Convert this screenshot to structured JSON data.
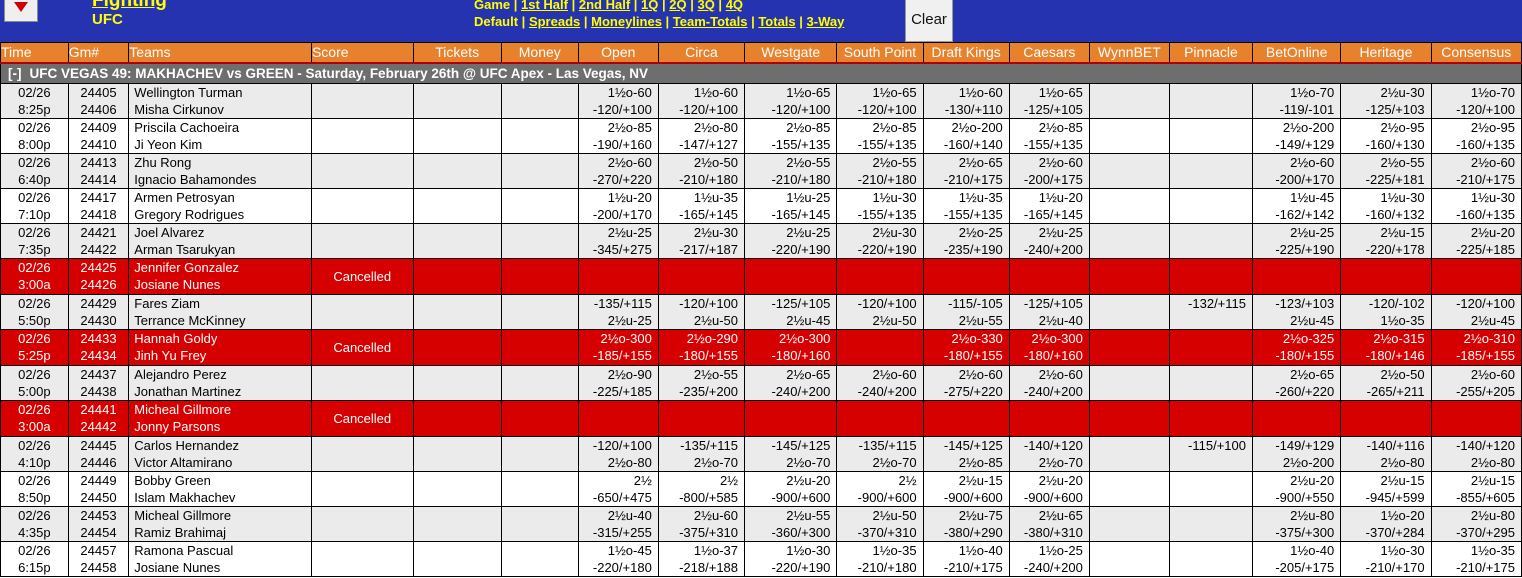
{
  "header": {
    "collapse_icon": "triangle-down",
    "league": "Fighting",
    "league_sub": "UFC",
    "periods": {
      "current": "Game",
      "options": [
        "1st Half",
        "2nd Half",
        "1Q",
        "2Q",
        "3Q",
        "4Q"
      ]
    },
    "bettypes": {
      "current": "Default",
      "options": [
        "Spreads",
        "Moneylines",
        "Team-Totals",
        "Totals",
        "3-Way"
      ]
    },
    "clear_label": "Clear",
    "accent_blue": "#2633b0",
    "accent_yellow": "#ffff00",
    "accent_orange": "#e8812c",
    "cancel_red": "#d60000"
  },
  "columns": [
    "Time",
    "Gm#",
    "Teams",
    "Score",
    "Tickets",
    "Money",
    "Open",
    "Circa",
    "Westgate",
    "South Point",
    "Draft Kings",
    "Caesars",
    "WynnBET",
    "Pinnacle",
    "BetOnline",
    "Heritage",
    "Consensus"
  ],
  "event": {
    "toggle": "[-]",
    "title": "UFC VEGAS 49: MAKHACHEV vs GREEN - Saturday, February 26th @ UFC Apex - Las Vegas, NV"
  },
  "rows": [
    {
      "date": "02/26",
      "time": "8:25p",
      "gm1": "24405",
      "gm2": "24406",
      "team1": "Wellington Turman",
      "team2": "Misha Cirkunov",
      "score": "",
      "tickets": [
        "",
        ""
      ],
      "money": [
        "",
        ""
      ],
      "cancelled": false,
      "books": {
        "open": [
          "1½o-60",
          "-120/+100"
        ],
        "circa": [
          "1½o-60",
          "-120/+100"
        ],
        "westgate": [
          "1½o-65",
          "-120/+100"
        ],
        "southpoint": [
          "1½o-65",
          "-120/+100"
        ],
        "draftkings": [
          "1½o-60",
          "-130/+110"
        ],
        "caesars": [
          "1½o-65",
          "-125/+105"
        ],
        "wynnbet": [
          "",
          ""
        ],
        "pinnacle": [
          "",
          ""
        ],
        "betonline": [
          "1½o-70",
          "-119/-101"
        ],
        "heritage": [
          "2½u-30",
          "-125/+103"
        ],
        "consensus": [
          "1½o-70",
          "-120/+100"
        ]
      }
    },
    {
      "date": "02/26",
      "time": "8:00p",
      "gm1": "24409",
      "gm2": "24410",
      "team1": "Priscila Cachoeira",
      "team2": "Ji Yeon Kim",
      "score": "",
      "tickets": [
        "",
        ""
      ],
      "money": [
        "",
        ""
      ],
      "cancelled": false,
      "books": {
        "open": [
          "2½o-85",
          "-190/+160"
        ],
        "circa": [
          "2½o-80",
          "-147/+127"
        ],
        "westgate": [
          "2½o-85",
          "-155/+135"
        ],
        "southpoint": [
          "2½o-85",
          "-155/+135"
        ],
        "draftkings": [
          "2½o-200",
          "-160/+140"
        ],
        "caesars": [
          "2½o-85",
          "-155/+135"
        ],
        "wynnbet": [
          "",
          ""
        ],
        "pinnacle": [
          "",
          ""
        ],
        "betonline": [
          "2½o-200",
          "-149/+129"
        ],
        "heritage": [
          "2½o-95",
          "-160/+130"
        ],
        "consensus": [
          "2½o-95",
          "-160/+135"
        ]
      }
    },
    {
      "date": "02/26",
      "time": "6:40p",
      "gm1": "24413",
      "gm2": "24414",
      "team1": "Zhu Rong",
      "team2": "Ignacio Bahamondes",
      "score": "",
      "tickets": [
        "",
        ""
      ],
      "money": [
        "",
        ""
      ],
      "cancelled": false,
      "books": {
        "open": [
          "2½o-60",
          "-270/+220"
        ],
        "circa": [
          "2½o-50",
          "-210/+180"
        ],
        "westgate": [
          "2½o-55",
          "-210/+180"
        ],
        "southpoint": [
          "2½o-55",
          "-210/+180"
        ],
        "draftkings": [
          "2½o-65",
          "-210/+175"
        ],
        "caesars": [
          "2½o-60",
          "-200/+175"
        ],
        "wynnbet": [
          "",
          ""
        ],
        "pinnacle": [
          "",
          ""
        ],
        "betonline": [
          "2½o-60",
          "-200/+170"
        ],
        "heritage": [
          "2½o-55",
          "-225/+181"
        ],
        "consensus": [
          "2½o-60",
          "-210/+175"
        ]
      }
    },
    {
      "date": "02/26",
      "time": "7:10p",
      "gm1": "24417",
      "gm2": "24418",
      "team1": "Armen Petrosyan",
      "team2": "Gregory Rodrigues",
      "score": "",
      "tickets": [
        "",
        ""
      ],
      "money": [
        "",
        ""
      ],
      "cancelled": false,
      "books": {
        "open": [
          "1½u-20",
          "-200/+170"
        ],
        "circa": [
          "1½u-35",
          "-165/+145"
        ],
        "westgate": [
          "1½u-25",
          "-165/+145"
        ],
        "southpoint": [
          "1½u-30",
          "-155/+135"
        ],
        "draftkings": [
          "1½u-35",
          "-155/+135"
        ],
        "caesars": [
          "1½u-20",
          "-165/+145"
        ],
        "wynnbet": [
          "",
          ""
        ],
        "pinnacle": [
          "",
          ""
        ],
        "betonline": [
          "1½u-45",
          "-162/+142"
        ],
        "heritage": [
          "1½u-30",
          "-160/+132"
        ],
        "consensus": [
          "1½u-30",
          "-160/+135"
        ]
      }
    },
    {
      "date": "02/26",
      "time": "7:35p",
      "gm1": "24421",
      "gm2": "24422",
      "team1": "Joel Alvarez",
      "team2": "Arman Tsarukyan",
      "score": "",
      "tickets": [
        "",
        ""
      ],
      "money": [
        "",
        ""
      ],
      "cancelled": false,
      "books": {
        "open": [
          "2½u-25",
          "-345/+275"
        ],
        "circa": [
          "2½u-30",
          "-217/+187"
        ],
        "westgate": [
          "2½u-25",
          "-220/+190"
        ],
        "southpoint": [
          "2½u-30",
          "-220/+190"
        ],
        "draftkings": [
          "2½o-25",
          "-235/+190"
        ],
        "caesars": [
          "2½u-25",
          "-240/+200"
        ],
        "wynnbet": [
          "",
          ""
        ],
        "pinnacle": [
          "",
          ""
        ],
        "betonline": [
          "2½u-25",
          "-225/+190"
        ],
        "heritage": [
          "2½u-15",
          "-220/+178"
        ],
        "consensus": [
          "2½u-20",
          "-225/+185"
        ]
      }
    },
    {
      "date": "02/26",
      "time": "3:00a",
      "gm1": "24425",
      "gm2": "24426",
      "team1": "Jennifer Gonzalez",
      "team2": "Josiane Nunes",
      "score": "Cancelled",
      "tickets": [
        "",
        ""
      ],
      "money": [
        "",
        ""
      ],
      "cancelled": true,
      "books": {
        "open": [
          "",
          ""
        ],
        "circa": [
          "",
          ""
        ],
        "westgate": [
          "",
          ""
        ],
        "southpoint": [
          "",
          ""
        ],
        "draftkings": [
          "",
          ""
        ],
        "caesars": [
          "",
          ""
        ],
        "wynnbet": [
          "",
          ""
        ],
        "pinnacle": [
          "",
          ""
        ],
        "betonline": [
          "",
          ""
        ],
        "heritage": [
          "",
          ""
        ],
        "consensus": [
          "",
          ""
        ]
      }
    },
    {
      "date": "02/26",
      "time": "5:50p",
      "gm1": "24429",
      "gm2": "24430",
      "team1": "Fares Ziam",
      "team2": "Terrance McKinney",
      "score": "",
      "tickets": [
        "",
        ""
      ],
      "money": [
        "",
        ""
      ],
      "cancelled": false,
      "books": {
        "open": [
          "-135/+115",
          "2½u-25"
        ],
        "circa": [
          "-120/+100",
          "2½u-50"
        ],
        "westgate": [
          "-125/+105",
          "2½u-45"
        ],
        "southpoint": [
          "-120/+100",
          "2½u-50"
        ],
        "draftkings": [
          "-115/-105",
          "2½u-55"
        ],
        "caesars": [
          "-125/+105",
          "2½u-40"
        ],
        "wynnbet": [
          "",
          ""
        ],
        "pinnacle": [
          "-132/+115",
          ""
        ],
        "betonline": [
          "-123/+103",
          "2½u-45"
        ],
        "heritage": [
          "-120/-102",
          "1½o-35"
        ],
        "consensus": [
          "-120/+100",
          "2½u-45"
        ]
      }
    },
    {
      "date": "02/26",
      "time": "5:25p",
      "gm1": "24433",
      "gm2": "24434",
      "team1": "Hannah Goldy",
      "team2": "Jinh Yu Frey",
      "score": "Cancelled",
      "tickets": [
        "",
        ""
      ],
      "money": [
        "",
        ""
      ],
      "cancelled": true,
      "books": {
        "open": [
          "2½o-300",
          "-185/+155"
        ],
        "circa": [
          "2½o-290",
          "-180/+155"
        ],
        "westgate": [
          "2½o-300",
          "-180/+160"
        ],
        "southpoint": [
          "",
          ""
        ],
        "draftkings": [
          "2½o-330",
          "-180/+155"
        ],
        "caesars": [
          "2½o-300",
          "-180/+160"
        ],
        "wynnbet": [
          "",
          ""
        ],
        "pinnacle": [
          "",
          ""
        ],
        "betonline": [
          "2½o-325",
          "-180/+155"
        ],
        "heritage": [
          "2½o-315",
          "-180/+146"
        ],
        "consensus": [
          "2½o-310",
          "-185/+155"
        ]
      }
    },
    {
      "date": "02/26",
      "time": "5:00p",
      "gm1": "24437",
      "gm2": "24438",
      "team1": "Alejandro Perez",
      "team2": "Jonathan Martinez",
      "score": "",
      "tickets": [
        "",
        ""
      ],
      "money": [
        "",
        ""
      ],
      "cancelled": false,
      "books": {
        "open": [
          "2½o-90",
          "-225/+185"
        ],
        "circa": [
          "2½o-55",
          "-235/+200"
        ],
        "westgate": [
          "2½o-65",
          "-240/+200"
        ],
        "southpoint": [
          "2½o-60",
          "-240/+200"
        ],
        "draftkings": [
          "2½o-60",
          "-275/+220"
        ],
        "caesars": [
          "2½o-60",
          "-240/+200"
        ],
        "wynnbet": [
          "",
          ""
        ],
        "pinnacle": [
          "",
          ""
        ],
        "betonline": [
          "2½o-65",
          "-260/+220"
        ],
        "heritage": [
          "2½o-50",
          "-265/+211"
        ],
        "consensus": [
          "2½o-60",
          "-255/+205"
        ]
      }
    },
    {
      "date": "02/26",
      "time": "3:00a",
      "gm1": "24441",
      "gm2": "24442",
      "team1": "Micheal Gillmore",
      "team2": "Jonny Parsons",
      "score": "Cancelled",
      "tickets": [
        "",
        ""
      ],
      "money": [
        "",
        ""
      ],
      "cancelled": true,
      "books": {
        "open": [
          "",
          ""
        ],
        "circa": [
          "",
          ""
        ],
        "westgate": [
          "",
          ""
        ],
        "southpoint": [
          "",
          ""
        ],
        "draftkings": [
          "",
          ""
        ],
        "caesars": [
          "",
          ""
        ],
        "wynnbet": [
          "",
          ""
        ],
        "pinnacle": [
          "",
          ""
        ],
        "betonline": [
          "",
          ""
        ],
        "heritage": [
          "",
          ""
        ],
        "consensus": [
          "",
          ""
        ]
      }
    },
    {
      "date": "02/26",
      "time": "4:10p",
      "gm1": "24445",
      "gm2": "24446",
      "team1": "Carlos Hernandez",
      "team2": "Victor Altamirano",
      "score": "",
      "tickets": [
        "",
        ""
      ],
      "money": [
        "",
        ""
      ],
      "cancelled": false,
      "books": {
        "open": [
          "-120/+100",
          "2½o-80"
        ],
        "circa": [
          "-135/+115",
          "2½o-70"
        ],
        "westgate": [
          "-145/+125",
          "2½o-70"
        ],
        "southpoint": [
          "-135/+115",
          "2½o-70"
        ],
        "draftkings": [
          "-145/+125",
          "2½o-85"
        ],
        "caesars": [
          "-140/+120",
          "2½o-70"
        ],
        "wynnbet": [
          "",
          ""
        ],
        "pinnacle": [
          "-115/+100",
          ""
        ],
        "betonline": [
          "-149/+129",
          "2½o-200"
        ],
        "heritage": [
          "-140/+116",
          "2½o-80"
        ],
        "consensus": [
          "-140/+120",
          "2½o-80"
        ]
      }
    },
    {
      "date": "02/26",
      "time": "8:50p",
      "gm1": "24449",
      "gm2": "24450",
      "team1": "Bobby Green",
      "team2": "Islam Makhachev",
      "score": "",
      "tickets": [
        "",
        ""
      ],
      "money": [
        "",
        ""
      ],
      "cancelled": false,
      "books": {
        "open": [
          "2½",
          "-650/+475"
        ],
        "circa": [
          "2½",
          "-800/+585"
        ],
        "westgate": [
          "2½u-20",
          "-900/+600"
        ],
        "southpoint": [
          "2½",
          "-900/+600"
        ],
        "draftkings": [
          "2½u-15",
          "-900/+600"
        ],
        "caesars": [
          "2½u-20",
          "-900/+600"
        ],
        "wynnbet": [
          "",
          ""
        ],
        "pinnacle": [
          "",
          ""
        ],
        "betonline": [
          "2½u-20",
          "-900/+550"
        ],
        "heritage": [
          "2½u-15",
          "-945/+599"
        ],
        "consensus": [
          "2½u-15",
          "-855/+605"
        ]
      }
    },
    {
      "date": "02/26",
      "time": "4:35p",
      "gm1": "24453",
      "gm2": "24454",
      "team1": "Micheal Gillmore",
      "team2": "Ramiz Brahimaj",
      "score": "",
      "tickets": [
        "",
        ""
      ],
      "money": [
        "",
        ""
      ],
      "cancelled": false,
      "books": {
        "open": [
          "2½u-40",
          "-315/+255"
        ],
        "circa": [
          "2½u-60",
          "-375/+310"
        ],
        "westgate": [
          "2½u-55",
          "-360/+300"
        ],
        "southpoint": [
          "2½u-50",
          "-370/+310"
        ],
        "draftkings": [
          "2½u-75",
          "-380/+290"
        ],
        "caesars": [
          "2½u-65",
          "-380/+310"
        ],
        "wynnbet": [
          "",
          ""
        ],
        "pinnacle": [
          "",
          ""
        ],
        "betonline": [
          "2½u-80",
          "-375/+300"
        ],
        "heritage": [
          "1½o-20",
          "-370/+284"
        ],
        "consensus": [
          "2½u-80",
          "-370/+295"
        ]
      }
    },
    {
      "date": "02/26",
      "time": "6:15p",
      "gm1": "24457",
      "gm2": "24458",
      "team1": "Ramona Pascual",
      "team2": "Josiane Nunes",
      "score": "",
      "tickets": [
        "",
        ""
      ],
      "money": [
        "",
        ""
      ],
      "cancelled": false,
      "books": {
        "open": [
          "1½o-45",
          "-220/+180"
        ],
        "circa": [
          "1½o-37",
          "-218/+188"
        ],
        "westgate": [
          "1½o-30",
          "-220/+190"
        ],
        "southpoint": [
          "1½o-35",
          "-210/+180"
        ],
        "draftkings": [
          "1½o-40",
          "-210/+175"
        ],
        "caesars": [
          "1½o-25",
          "-240/+200"
        ],
        "wynnbet": [
          "",
          ""
        ],
        "pinnacle": [
          "",
          ""
        ],
        "betonline": [
          "1½o-40",
          "-205/+175"
        ],
        "heritage": [
          "1½o-30",
          "-210/+170"
        ],
        "consensus": [
          "1½o-35",
          "-210/+175"
        ]
      }
    }
  ]
}
